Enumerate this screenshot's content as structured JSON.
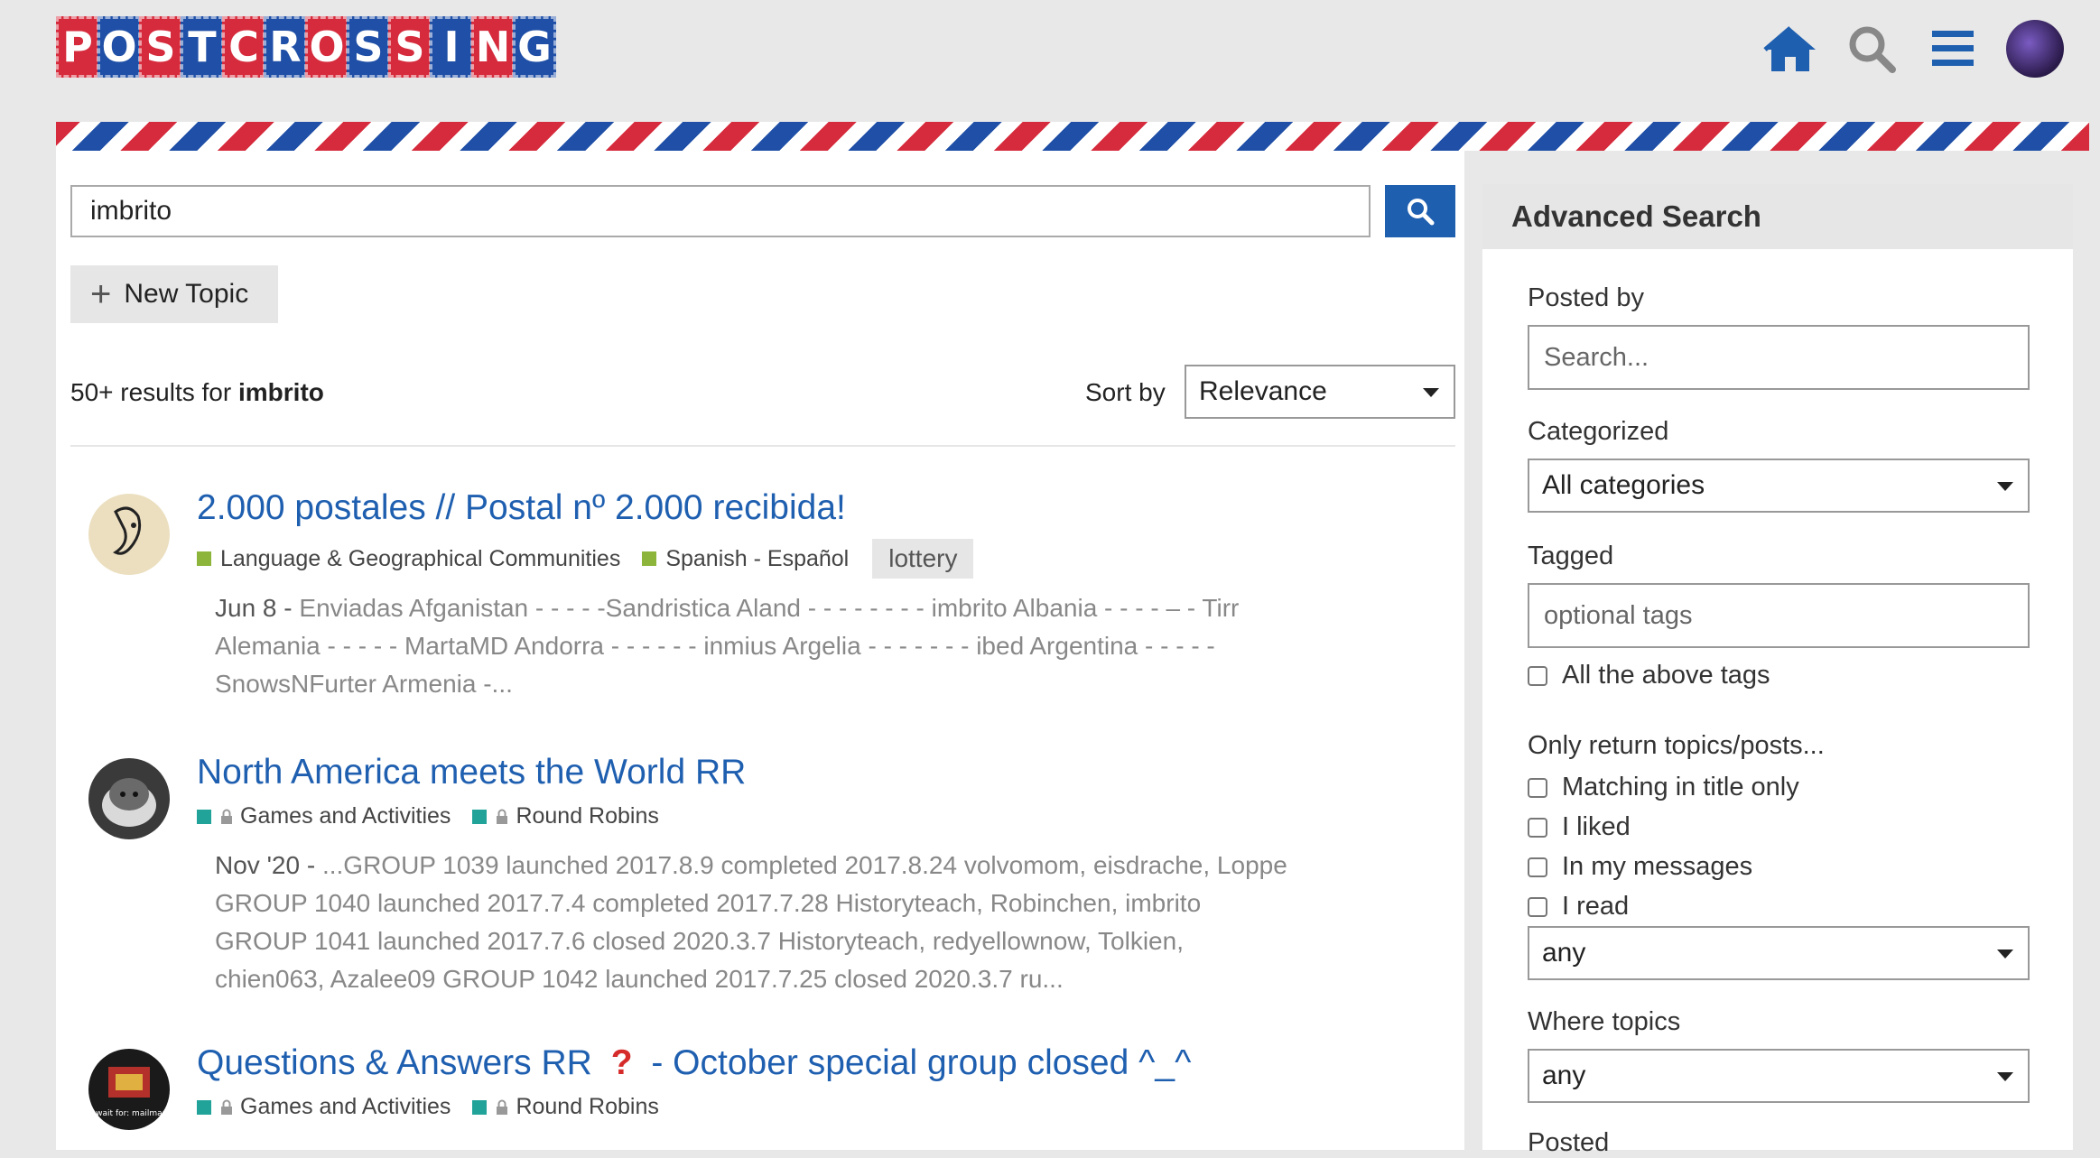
{
  "header": {
    "logo_letters": [
      "P",
      "O",
      "S",
      "T",
      "C",
      "R",
      "O",
      "S",
      "S",
      "I",
      "N",
      "G"
    ],
    "icons": [
      "home-icon",
      "search-icon",
      "menu-icon",
      "user-avatar"
    ],
    "colors": {
      "red": "#d62b3c",
      "blue": "#1f4fa6",
      "link": "#1f5fb0"
    }
  },
  "search": {
    "query": "imbrito",
    "new_topic_label": "New Topic",
    "results_prefix": "50+ results for",
    "results_term": "imbrito",
    "sort_label": "Sort by",
    "sort_value": "Relevance"
  },
  "results": [
    {
      "title": "2.000 postales // Postal nº 2.000 recibida!",
      "categories": [
        {
          "label": "Language & Geographical Communities",
          "color": "#8db53c",
          "locked": false
        },
        {
          "label": "Spanish - Español",
          "color": "#8db53c",
          "locked": false
        }
      ],
      "tag": "lottery",
      "date": "Jun 8",
      "excerpt_lines": [
        "Enviadas Afganistan - - - - -Sandristica Aland - - - - - - - - imbrito Albania - - - - – - Tirr",
        "Alemania - - - - - MartaMD Andorra - - - - - - inmius Argelia - - - - - - - ibed Argentina - - - - -",
        "SnowsNFurter Armenia -..."
      ]
    },
    {
      "title": "North America meets the World RR",
      "categories": [
        {
          "label": "Games and Activities",
          "color": "#21a39a",
          "locked": true
        },
        {
          "label": "Round Robins",
          "color": "#21a39a",
          "locked": true
        }
      ],
      "tag": "",
      "date": "Nov '20",
      "excerpt_lines": [
        "...GROUP 1039 launched 2017.8.9 completed 2017.8.24 volvomom, eisdrache, Loppe",
        "GROUP 1040 launched 2017.7.4 completed 2017.7.28 Historyteach, Robinchen, imbrito",
        "GROUP 1041 launched 2017.7.6 closed 2020.3.7 Historyteach, redyellownow, Tolkien,",
        "chien063, Azalee09 GROUP 1042 launched 2017.7.25 closed 2020.3.7 ru..."
      ]
    },
    {
      "title_a": "Questions & Answers RR",
      "title_b": "- October special group closed ^_^",
      "categories": [
        {
          "label": "Games and Activities",
          "color": "#21a39a",
          "locked": true
        },
        {
          "label": "Round Robins",
          "color": "#21a39a",
          "locked": true
        }
      ],
      "avatar_caption": "I wait for: mailman"
    }
  ],
  "sidebar": {
    "heading": "Advanced Search",
    "posted_by_label": "Posted by",
    "posted_by_placeholder": "Search...",
    "categorized_label": "Categorized",
    "categorized_value": "All categories",
    "tagged_label": "Tagged",
    "tagged_placeholder": "optional tags",
    "all_tags_label": "All the above tags",
    "only_return_label": "Only return topics/posts...",
    "checks": [
      "Matching in title only",
      "I liked",
      "In my messages",
      "I read"
    ],
    "only_return_select": "any",
    "where_topics_label": "Where topics",
    "where_topics_select": "any",
    "posted_label": "Posted"
  }
}
